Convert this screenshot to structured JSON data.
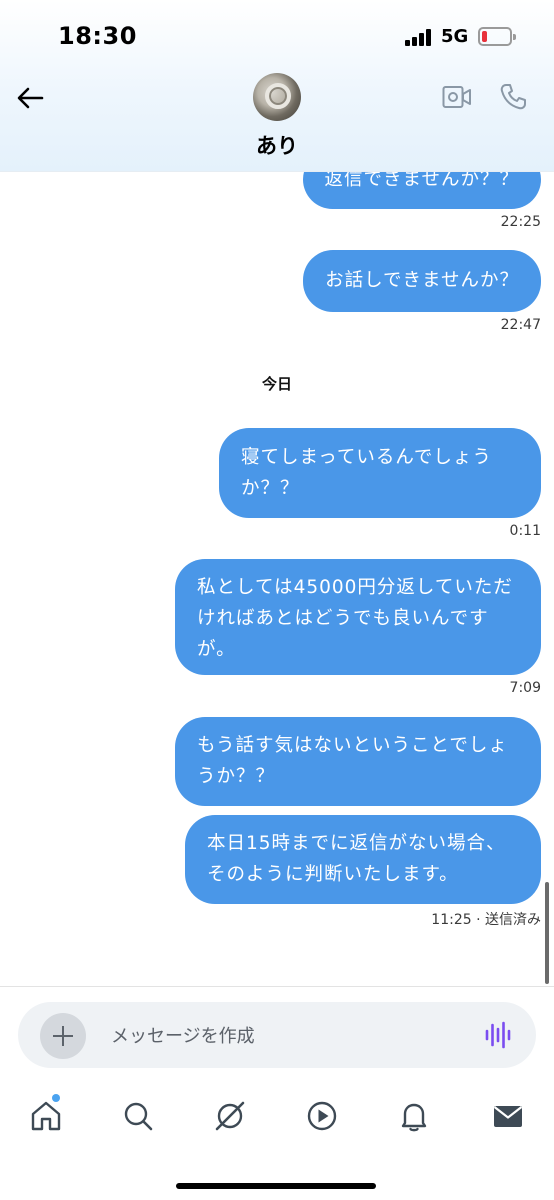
{
  "status_bar": {
    "time": "18:30",
    "network": "5G"
  },
  "header": {
    "contact_name": "あり"
  },
  "messages": [
    {
      "text": "返信できませんか？？",
      "time": "22:25"
    },
    {
      "text": "お話しできませんか？",
      "time": "22:47"
    },
    {
      "text": "寝てしまっているんでしょうか？？",
      "time": "0:11"
    },
    {
      "text": "私としては45000円分返していただければあとはどうでも良いんですが。",
      "time": "7:09"
    },
    {
      "text": "もう話す気はないということでしょうか？？",
      "time": ""
    },
    {
      "text": "本日15時までに返信がない場合、そのように判断いたします。",
      "time": "11:25 · 送信済み"
    }
  ],
  "date_separator": "今日",
  "composer": {
    "placeholder": "メッセージを作成"
  },
  "tabbar": {
    "items": [
      "home-icon",
      "search-icon",
      "grok-icon",
      "video-icon",
      "bell-icon",
      "mail-icon"
    ],
    "active": "mail-icon"
  },
  "colors": {
    "bubble": "#4a97e8",
    "voice_accent": "#7b4df0",
    "notif_dot": "#4aa3f0",
    "battery_low": "#e8323c"
  }
}
